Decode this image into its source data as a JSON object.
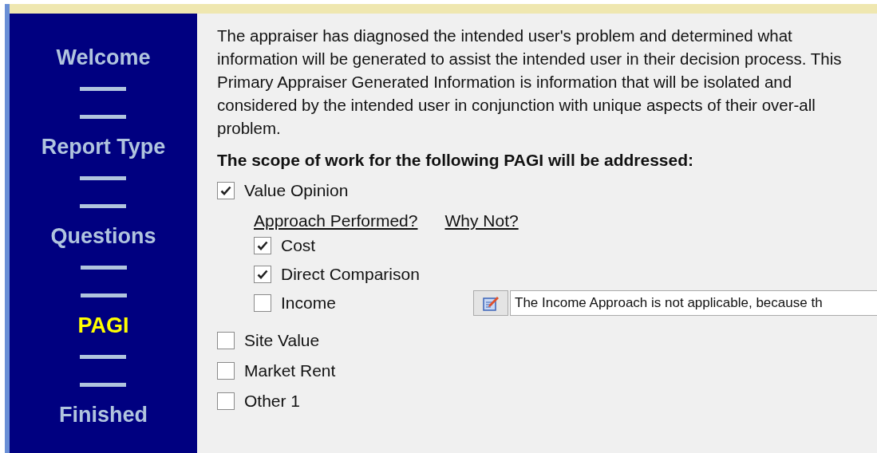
{
  "steps": [
    {
      "label": "Welcome",
      "selected": false
    },
    {
      "label": "Report Type",
      "selected": false
    },
    {
      "label": "Questions",
      "selected": false
    },
    {
      "label": "PAGI",
      "selected": true
    },
    {
      "label": "Finished",
      "selected": false
    }
  ],
  "intro": "The appraiser has diagnosed the intended user's problem and determined what information will be generated to assist the intended user in their decision process.  This Primary Appraiser Generated Information is information that will be isolated and considered by the intended user in conjunction with unique aspects of their over-all problem.",
  "scope_heading": "The scope of work for the following PAGI will be addressed:",
  "options": [
    {
      "label": "Value Opinion",
      "checked": true,
      "approach_header": "Approach Performed?",
      "why_not_header": "Why Not?",
      "approaches": [
        {
          "label": "Cost",
          "checked": true
        },
        {
          "label": "Direct Comparison",
          "checked": true
        },
        {
          "label": "Income",
          "checked": false,
          "reason": "The Income Approach is not applicable, because th"
        }
      ]
    },
    {
      "label": "Site Value",
      "checked": false
    },
    {
      "label": "Market Rent",
      "checked": false
    },
    {
      "label": "Other 1",
      "checked": false
    }
  ]
}
